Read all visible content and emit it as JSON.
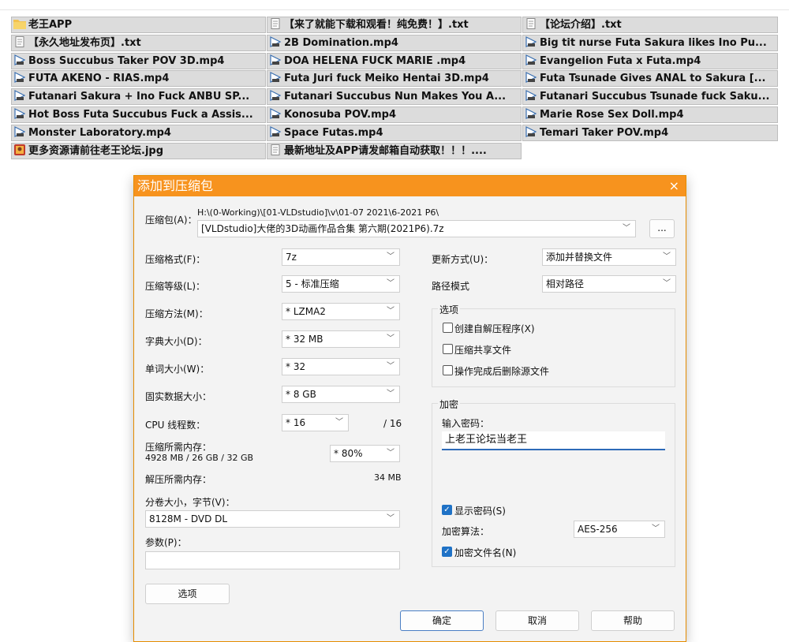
{
  "file_grid": [
    [
      {
        "icon": "folder",
        "name": "老王APP"
      },
      {
        "icon": "text",
        "name": "【来了就能下载和观看！纯免费！】.txt"
      },
      {
        "icon": "text",
        "name": "【论坛介绍】.txt"
      }
    ],
    [
      {
        "icon": "text",
        "name": "【永久地址发布页】.txt"
      },
      {
        "icon": "video",
        "name": "2B Domination.mp4"
      },
      {
        "icon": "video",
        "name": "Big tit nurse Futa Sakura likes Ino Pu..."
      }
    ],
    [
      {
        "icon": "video",
        "name": "Boss Succubus Taker POV 3D.mp4"
      },
      {
        "icon": "video",
        "name": "DOA HELENA FUCK MARIE .mp4"
      },
      {
        "icon": "video",
        "name": "Evangelion Futa x Futa.mp4"
      }
    ],
    [
      {
        "icon": "video",
        "name": "FUTA  AKENO - RIAS.mp4"
      },
      {
        "icon": "video",
        "name": "Futa Juri fuck Meiko Hentai 3D.mp4"
      },
      {
        "icon": "video",
        "name": "Futa Tsunade Gives ANAL to Sakura [..."
      }
    ],
    [
      {
        "icon": "video",
        "name": "Futanari Sakura + Ino Fuck ANBU SP..."
      },
      {
        "icon": "video",
        "name": "Futanari Succubus Nun Makes You A..."
      },
      {
        "icon": "video",
        "name": "Futanari Succubus Tsunade fuck Saku..."
      }
    ],
    [
      {
        "icon": "video",
        "name": "Hot Boss Futa Succubus Fuck a Assis..."
      },
      {
        "icon": "video",
        "name": "Konosuba POV.mp4"
      },
      {
        "icon": "video",
        "name": "Marie Rose Sex Doll.mp4"
      }
    ],
    [
      {
        "icon": "video",
        "name": "Monster Laboratory.mp4"
      },
      {
        "icon": "video",
        "name": "Space Futas.mp4"
      },
      {
        "icon": "video",
        "name": "Temari Taker POV.mp4"
      }
    ],
    [
      {
        "icon": "image",
        "name": "更多资源请前往老王论坛.jpg"
      },
      {
        "icon": "text",
        "name": "最新地址及APP请发邮箱自动获取！！！...."
      },
      null
    ]
  ],
  "dialog": {
    "title": "添加到压缩包",
    "close": "×",
    "archive_label": "压缩包(A)：",
    "archive_path": "H:\\(0-Working)\\[01-VLDstudio]\\v\\01-07 2021\\6-2021 P6\\",
    "archive_name": "[VLDstudio]大佬的3D动画作品合集 第六期(2021P6).7z",
    "browse": "...",
    "format_label": "压缩格式(F)：",
    "format_value": "7z",
    "level_label": "压缩等级(L)：",
    "level_value": "5 - 标准压缩",
    "method_label": "压缩方法(M)：",
    "method_value": "* LZMA2",
    "dict_label": "字典大小(D)：",
    "dict_value": "* 32 MB",
    "word_label": "单词大小(W)：",
    "word_value": "* 32",
    "solid_label": "固实数据大小：",
    "solid_value": "* 8 GB",
    "cpu_label": "CPU 线程数：",
    "cpu_value": "* 16",
    "cpu_total": "/ 16",
    "mem_comp_label": "压缩所需内存：",
    "mem_comp_detail": "4928 MB / 26 GB / 32 GB",
    "mem_comp_pct": "* 80%",
    "mem_decomp_label": "解压所需内存：",
    "mem_decomp_value": "34 MB",
    "volume_label": "分卷大小，字节(V)：",
    "volume_value": "8128M - DVD DL",
    "params_label": "参数(P)：",
    "options_button": "选项",
    "update_label": "更新方式(U)：",
    "update_value": "添加并替换文件",
    "path_label": "路径模式",
    "path_value": "相对路径",
    "options_group": "选项",
    "opt_sfx": "创建自解压程序(X)",
    "opt_shared": "压缩共享文件",
    "opt_delete": "操作完成后删除源文件",
    "encrypt_group": "加密",
    "pwd_label": "输入密码：",
    "pwd_value": "上老王论坛当老王",
    "show_pwd": "显示密码(S)",
    "enc_method_label": "加密算法：",
    "enc_method_value": "AES-256",
    "enc_names": "加密文件名(N)",
    "ok": "确定",
    "cancel": "取消",
    "help": "帮助"
  }
}
